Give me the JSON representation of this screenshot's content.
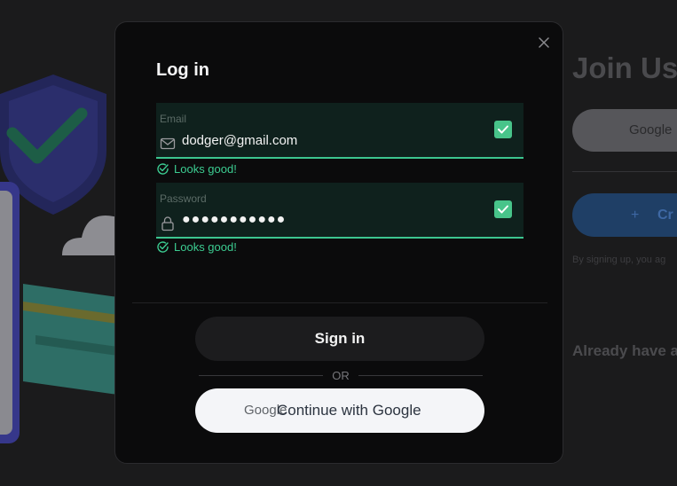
{
  "background": {
    "title": "Join Us",
    "google_button_text": "Google",
    "create_button_text": "Cr",
    "terms_text": "By signing up, you ag",
    "already_text": "Already have a"
  },
  "modal": {
    "title": "Log in",
    "close_icon": "close-icon",
    "email": {
      "label": "Email",
      "value": "dodger@gmail.com",
      "icon": "mail-icon",
      "status": "Looks good!"
    },
    "password": {
      "label": "Password",
      "value": "●●●●●●●●●●●",
      "icon": "lock-icon",
      "status": "Looks good!"
    },
    "signin_label": "Sign in",
    "or_label": "OR",
    "google": {
      "logo_text": "Google",
      "label": "Continue with Google"
    }
  },
  "colors": {
    "accent_green": "#3ccc91",
    "field_bg": "#0f211d",
    "modal_bg": "#0b0b0c"
  }
}
